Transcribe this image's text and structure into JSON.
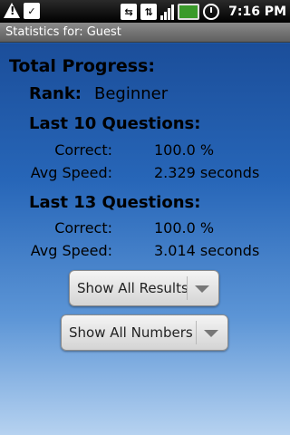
{
  "status_bar": {
    "time": "7:16 PM",
    "left_icons": [
      "warning-icon",
      "notification-icon"
    ],
    "right_icons": [
      "usb-icon",
      "sync-icon",
      "signal-icon",
      "battery-icon",
      "alarm-icon"
    ]
  },
  "window": {
    "title": "Statistics for: Guest"
  },
  "stats": {
    "heading": "Total Progress:",
    "rank_label": "Rank:",
    "rank_value": "Beginner",
    "sections": [
      {
        "title": "Last 10 Questions:",
        "correct_label": "Correct:",
        "correct_value": "100.0 %",
        "speed_label": "Avg Speed:",
        "speed_value": "2.329 seconds"
      },
      {
        "title": "Last 13 Questions:",
        "correct_label": "Correct:",
        "correct_value": "100.0 %",
        "speed_label": "Avg Speed:",
        "speed_value": "3.014 seconds"
      }
    ]
  },
  "controls": {
    "results_selected": "Show All Results",
    "numbers_selected": "Show All Numbers"
  },
  "colors": {
    "background_top": "#1b4e9a",
    "background_bottom": "#b6d2f0",
    "title_bar": "#6e6e6e",
    "status_bar": "#000000"
  }
}
